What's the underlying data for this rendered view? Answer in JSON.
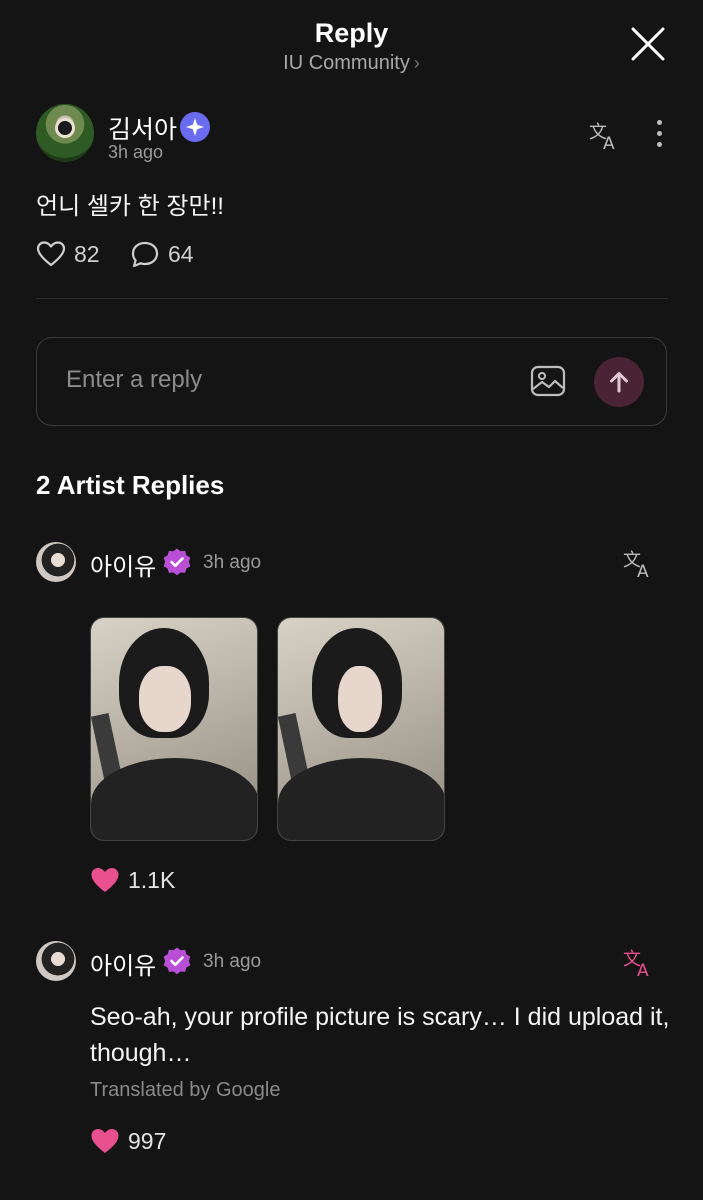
{
  "header": {
    "title": "Reply",
    "community": "IU Community",
    "chevron": "›"
  },
  "post": {
    "author": "김서아",
    "time": "3h ago",
    "body": "언니 셀카 한 장만!!",
    "likes": "82",
    "comments": "64"
  },
  "reply_input": {
    "placeholder": "Enter a reply"
  },
  "artist_replies": {
    "title": "2 Artist Replies",
    "items": [
      {
        "author": "아이유",
        "time": "3h ago",
        "photos": 2,
        "likes": "1.1K"
      },
      {
        "author": "아이유",
        "time": "3h ago",
        "text": "Seo-ah, your profile picture is scary… I did upload it, though…",
        "translated_by": "Translated by Google",
        "likes": "997"
      }
    ]
  },
  "colors": {
    "background": "#141414",
    "like_heart": "#e8508f",
    "verified_badge": "#b84fd6",
    "star_badge": "#6a6cf0",
    "translate_active": "#e8508f",
    "send_button": "#4a2334"
  },
  "icons": [
    "close-icon",
    "star-badge-icon",
    "translate-icon",
    "more-icon",
    "heart-outline-icon",
    "comment-icon",
    "image-icon",
    "send-arrow-icon",
    "verified-badge-icon",
    "heart-filled-icon"
  ]
}
